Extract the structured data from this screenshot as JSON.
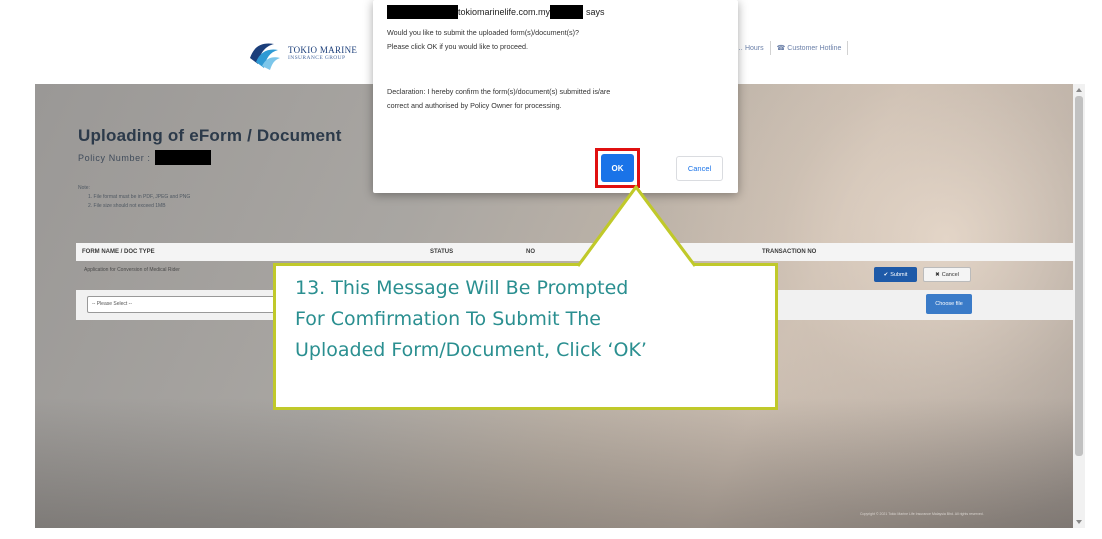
{
  "header": {
    "logo": {
      "line1": "TOKIO MARINE",
      "line2": "INSURANCE GROUP"
    },
    "links": [
      {
        "label": "… Hours"
      },
      {
        "label": "☎ Customer Hotline"
      }
    ]
  },
  "page": {
    "title": "Uploading of eForm / Document",
    "policy_number_label": "Policy Number :",
    "note": {
      "heading": "Note:",
      "items": [
        "1. File format must be in PDF, JPEG and PNG",
        "2. File size should not exceed 1MB"
      ]
    },
    "table": {
      "headers": {
        "form_name": "FORM NAME / DOC TYPE",
        "status": "STATUS",
        "no": "NO",
        "transaction_no": "TRANSACTION NO"
      },
      "rows": [
        {
          "form_name": "Application for Conversion of Medical Rider",
          "submit_label": "Submit",
          "cancel_label": "Cancel"
        }
      ],
      "select": {
        "value": "-- Please Select --"
      },
      "choose_file_label": "Choose file"
    },
    "footer": "Copyright © 2021 Tokio Marine Life Insurance Malaysia Bhd. All rights reserved."
  },
  "dialog": {
    "title_mid": "tokiomarinelife.com.my",
    "title_end": "says",
    "message_lines": [
      "Would you like to submit the uploaded form(s)/document(s)?",
      "Please click OK if you would like to proceed."
    ],
    "declaration_lines": [
      "Declaration: I hereby confirm the form(s)/document(s) submitted is/are",
      "correct and authorised by Policy Owner for processing."
    ],
    "ok_label": "OK",
    "cancel_label": "Cancel"
  },
  "callout": {
    "lines": [
      "13. This Message Will Be Prompted",
      "For Comfirmation To Submit The",
      "Uploaded Form/Document, Click ‘OK’"
    ]
  },
  "colors": {
    "accent_callout_border": "#c0c92a",
    "callout_text": "#2a8f90",
    "ok_button": "#1a73e8",
    "highlight": "#e01010",
    "submit_button": "#1e5aa8"
  }
}
